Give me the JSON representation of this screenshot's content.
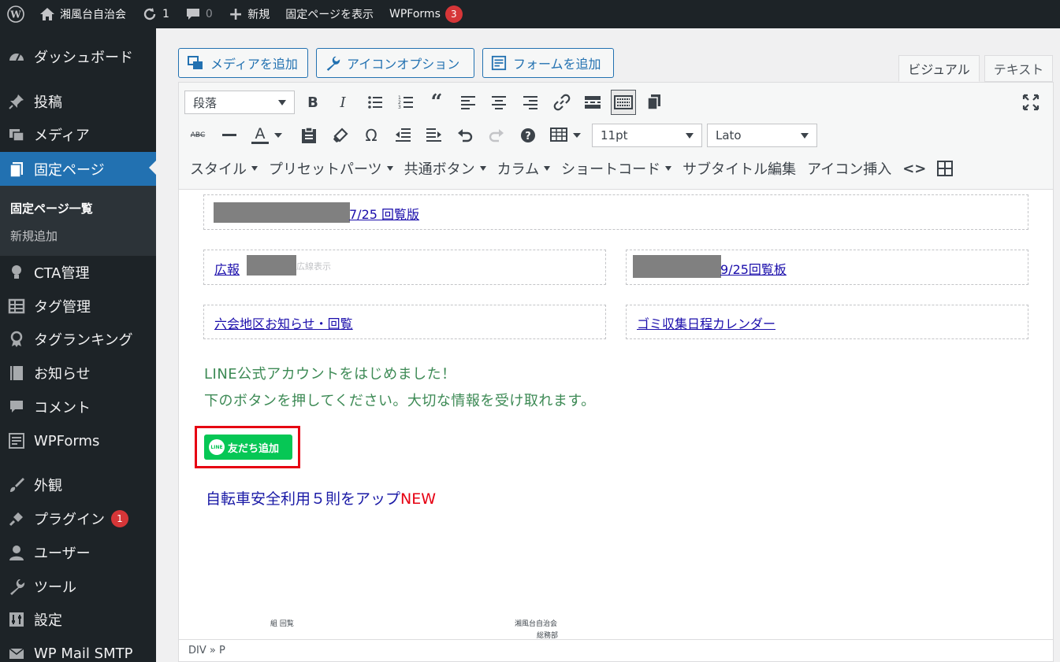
{
  "admin_bar": {
    "site_name": "湘風台自治会",
    "updates_count": "1",
    "comments_count": "0",
    "new_label": "新規",
    "view_page_label": "固定ページを表示",
    "wpforms_label": "WPForms",
    "wpforms_badge": "3"
  },
  "sidebar": {
    "dashboard": "ダッシュボード",
    "posts": "投稿",
    "media": "メディア",
    "pages": "固定ページ",
    "pages_list": "固定ページ一覧",
    "add_new": "新規追加",
    "cta": "CTA管理",
    "tags": "タグ管理",
    "tag_ranking": "タグランキング",
    "news": "お知らせ",
    "comments": "コメント",
    "wpforms": "WPForms",
    "appearance": "外観",
    "plugins": "プラグイン",
    "plugins_badge": "1",
    "users": "ユーザー",
    "tools": "ツール",
    "settings": "設定",
    "wp_mail_smtp": "WP Mail SMTP"
  },
  "editor_buttons": {
    "add_media": "メディアを追加",
    "icon_options": "アイコンオプション",
    "add_form": "フォームを追加"
  },
  "tabs": {
    "visual": "ビジュアル",
    "text": "テキスト"
  },
  "toolbar": {
    "format_select": "段落",
    "font_size": "11pt",
    "font_family": "Lato",
    "style_menu": "スタイル",
    "preset_parts": "プリセットパーツ",
    "common_button": "共通ボタン",
    "column": "カラム",
    "shortcode": "ショートコード",
    "subtitle_edit": "サブタイトル編集",
    "icon_insert": "アイコン挿入"
  },
  "content": {
    "link1": "7/25 回覧版",
    "link2_prefix": "広報",
    "link2_faint": "広線表示",
    "link3": "9/25回覧板",
    "link4": "六会地区お知らせ・回覧",
    "link5": "ゴミ収集日程カレンダー",
    "line_intro_1": "LINE公式アカウントをはじめました！",
    "line_intro_2": "下のボタンを押してください。大切な情報を受け取れます。",
    "line_button_logo": "LINE",
    "line_button": "友だち追加",
    "bicycle_text": "自転車安全利用５則をアップ",
    "new_mark": "NEW",
    "doc_left": "組 回覧",
    "doc_right_1": "湘風台自治会",
    "doc_right_2": "総務部"
  },
  "statusbar": {
    "path": "DIV » P"
  }
}
